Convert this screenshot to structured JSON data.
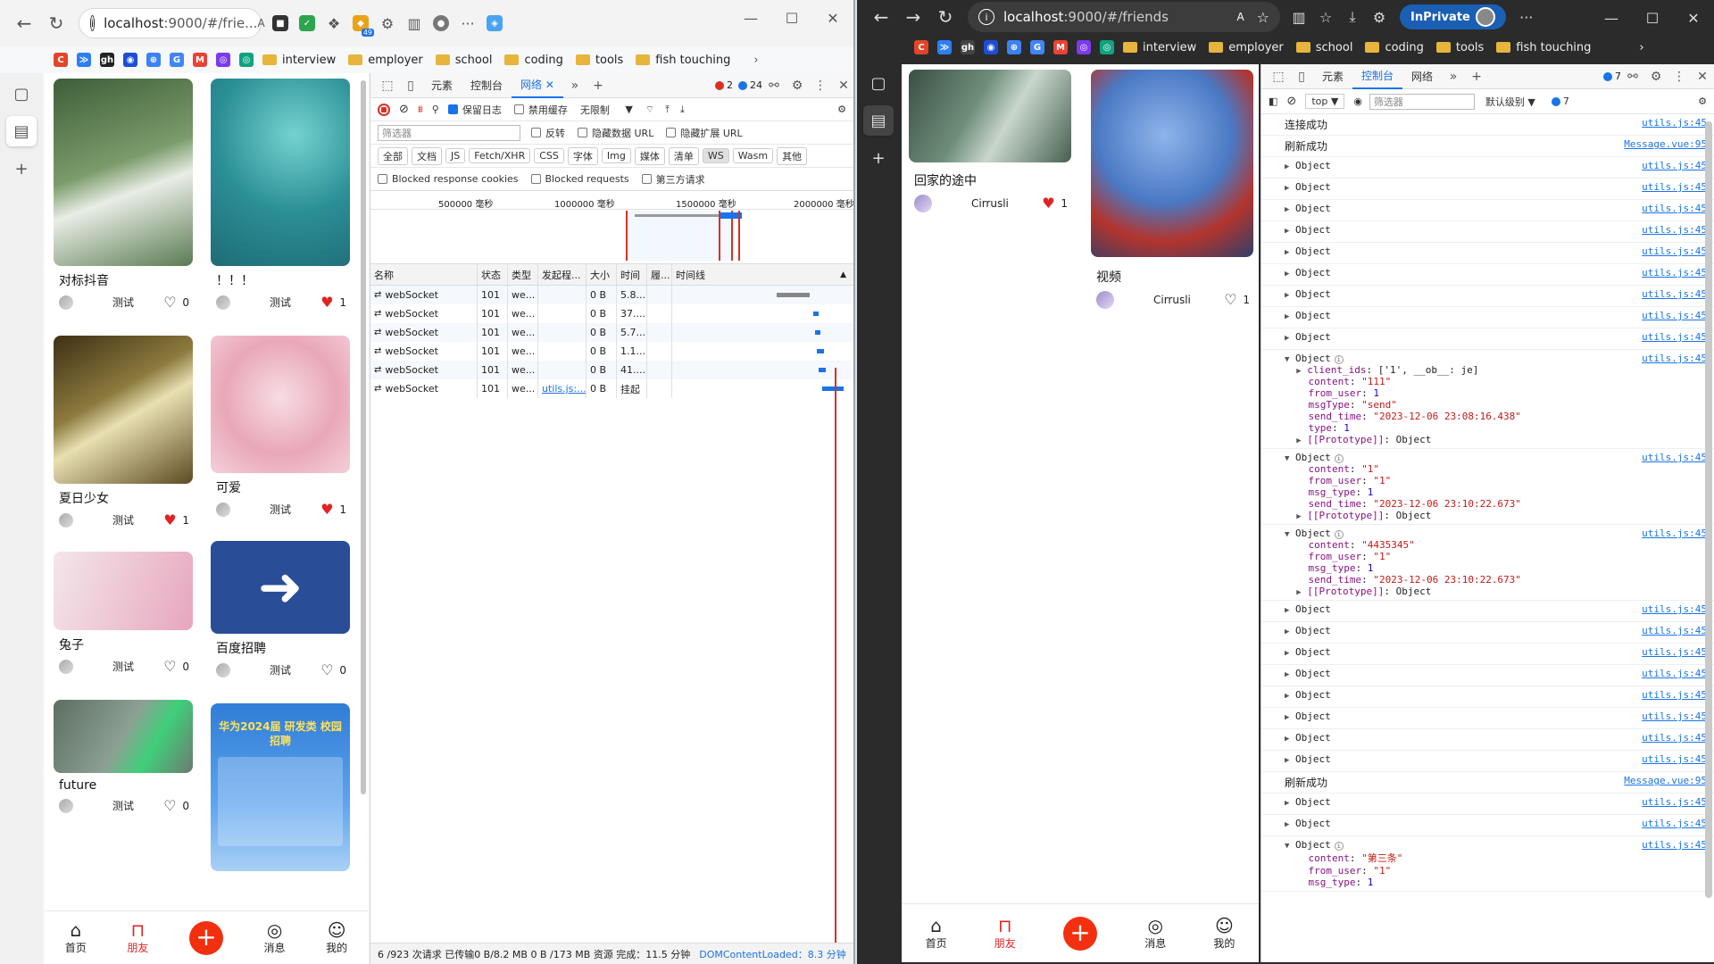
{
  "left_browser": {
    "url_host": "localhost",
    "url_path": ":9000/#/frie...",
    "ext_badge": "49",
    "bookmarks_ico": [
      "C",
      "≫",
      "gh",
      "◉",
      "⊕",
      "G",
      "M",
      "◎",
      "◎"
    ],
    "bookmarks": [
      "interview",
      "employer",
      "school",
      "coding",
      "tools",
      "fish touching"
    ],
    "cards": [
      {
        "title": "对标抖音",
        "user": "测试",
        "likes": "0",
        "liked": false,
        "img": "#5a7b52"
      },
      {
        "title": "！！！",
        "user": "测试",
        "likes": "1",
        "liked": true,
        "img": "#3aa5a6"
      },
      {
        "title": "夏日少女",
        "user": "测试",
        "likes": "1",
        "liked": true,
        "img": "#6f5b2e"
      },
      {
        "title": "可爱",
        "user": "测试",
        "likes": "1",
        "liked": true,
        "img": "#f2c7d1"
      },
      {
        "title": "兔子",
        "user": "测试",
        "likes": "0",
        "liked": false,
        "img": "#ead4dc"
      },
      {
        "title": "百度招聘",
        "user": "测试",
        "likes": "0",
        "liked": false,
        "img": "#2a4d97"
      },
      {
        "title": "future",
        "user": "测试",
        "likes": "0",
        "liked": false,
        "img": "#77857a"
      },
      {
        "title": "",
        "user": "",
        "likes": "",
        "liked": false,
        "img": "#2f7dd6"
      }
    ],
    "poster_title": "华为2024届 研发类 校园招聘",
    "nav": [
      "首页",
      "朋友",
      "消息",
      "我的"
    ]
  },
  "devtools_left": {
    "tabs": [
      "元素",
      "控制台",
      "网络"
    ],
    "error_count": "2",
    "msg_count": "24",
    "toolbar": {
      "preserve": "保留日志",
      "disable_cache": "禁用缓存",
      "throttle": "无限制"
    },
    "filter_placeholder": "筛选器",
    "filter_opts": [
      "反转",
      "隐藏数据 URL",
      "隐藏扩展 URL"
    ],
    "types": [
      "全部",
      "文档",
      "JS",
      "Fetch/XHR",
      "CSS",
      "字体",
      "Img",
      "媒体",
      "清单",
      "WS",
      "Wasm",
      "其他"
    ],
    "extra_opts": [
      "Blocked response cookies",
      "Blocked requests",
      "第三方请求"
    ],
    "timeline_ticks": [
      "500000 毫秒",
      "1000000 毫秒",
      "1500000 毫秒",
      "2000000 毫秒"
    ],
    "columns": [
      "名称",
      "状态",
      "类型",
      "发起程...",
      "大小",
      "时间",
      "履...",
      "时间线"
    ],
    "rows": [
      {
        "name": "webSocket",
        "status": "101",
        "type": "we...",
        "init": "",
        "size": "0 B",
        "time": "5.8..."
      },
      {
        "name": "webSocket",
        "status": "101",
        "type": "we...",
        "init": "",
        "size": "0 B",
        "time": "37...."
      },
      {
        "name": "webSocket",
        "status": "101",
        "type": "we...",
        "init": "",
        "size": "0 B",
        "time": "5.7..."
      },
      {
        "name": "webSocket",
        "status": "101",
        "type": "we...",
        "init": "",
        "size": "0 B",
        "time": "1.1..."
      },
      {
        "name": "webSocket",
        "status": "101",
        "type": "we...",
        "init": "",
        "size": "0 B",
        "time": "41...."
      },
      {
        "name": "webSocket",
        "status": "101",
        "type": "we...",
        "init": "utils.js:...",
        "size": "0 B",
        "time": "挂起"
      }
    ],
    "status": "6 /923 次请求  已传输0 B/8.2 MB  0 B /173 MB 资源  完成：11.5 分钟",
    "status_dom": "DOMContentLoaded：8.3 分钟"
  },
  "right_browser": {
    "url_host": "localhost",
    "url_path": ":9000/#/friends",
    "inprivate": "InPrivate",
    "cards": [
      {
        "title": "回家的途中",
        "user": "Cirrusli",
        "likes": "1",
        "liked": true,
        "img": "#4f6a55"
      },
      {
        "title": "视频",
        "user": "Cirrusli",
        "likes": "1",
        "liked": false,
        "img": "#5b86c7"
      }
    ],
    "nav": [
      "首页",
      "朋友",
      "消息",
      "我的"
    ]
  },
  "devtools_right": {
    "tabs": [
      "元素",
      "控制台",
      "网络"
    ],
    "badge": "7",
    "context": "top",
    "filter_placeholder": "筛选器",
    "level": "默认级别",
    "level_badge": "7"
  }
}
